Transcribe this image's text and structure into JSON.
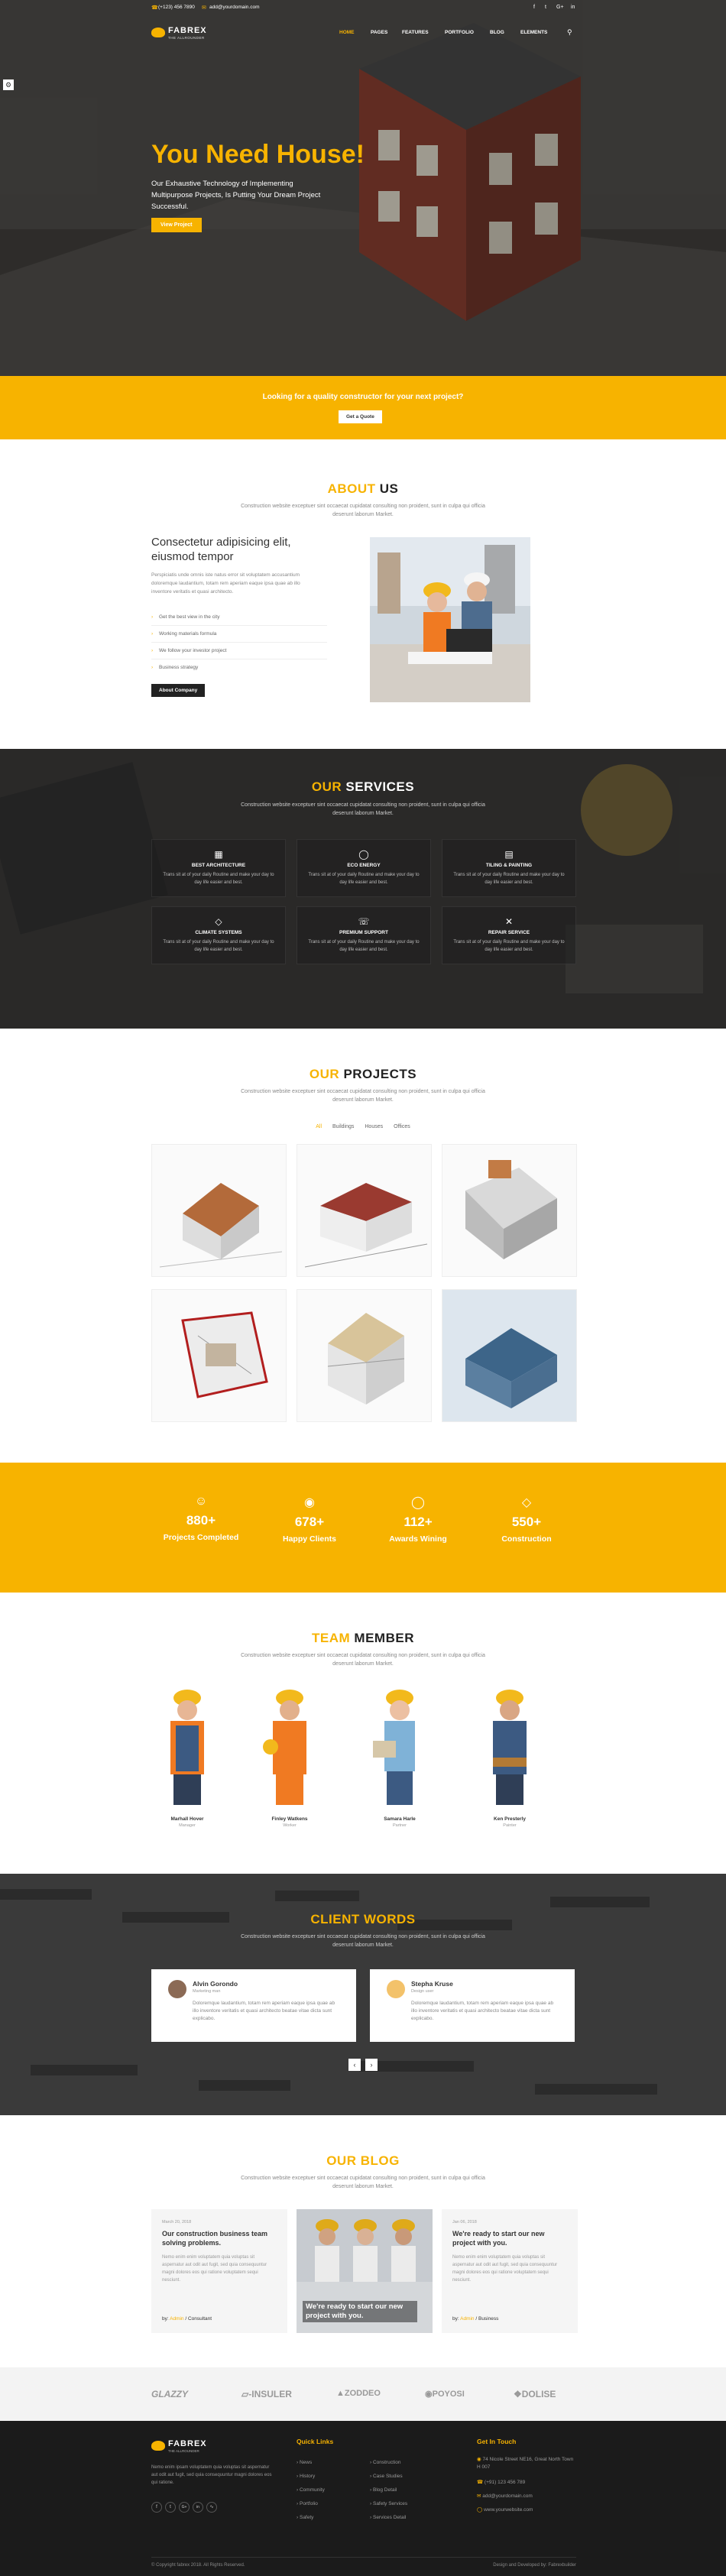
{
  "topbar": {
    "phone": "(+123) 456 7890",
    "email": "add@yourdomain.com"
  },
  "brand": {
    "name": "FABREX",
    "tag": "THE ALLROUNDER"
  },
  "nav": [
    "HOME",
    "PAGES",
    "FEATURES",
    "PORTFOLIO",
    "BLOG",
    "ELEMENTS"
  ],
  "hero": {
    "title": "You Need House!",
    "text": "Our Exhaustive Technology of Implementing Multipurpose Projects, Is Putting Your Dream Project Successful.",
    "button": "View Project"
  },
  "quote": {
    "text": "Looking for a quality constructor for your next project?",
    "button": "Get a Quote"
  },
  "about": {
    "title_y": "ABOUT",
    "title_d": "US",
    "sub": "Construction website exceptuer sint occaecat cupidatat consulting non proident, sunt in culpa qui officia deserunt laborum Market.",
    "heading": "Consectetur adipisicing elit, eiusmod tempor",
    "para": "Perspiciatis unde omnis iste natus error sit voluptatem accusantium doloremque laudantium, totam rem aperiam eaque ipsa quae ab illo inventore veritatis et quasi architecto.",
    "list": [
      "Get the best view in the city",
      "Working materials formula",
      "We follow your investor project",
      "Business strategy"
    ],
    "button": "About Company"
  },
  "services": {
    "title_y": "OUR",
    "title_d": "SERVICES",
    "sub": "Construction website exceptuer sint occaecat cupidatat consulting non proident, sunt in culpa qui officia deserunt laborum Market.",
    "items": [
      {
        "title": "BEST ARCHITECTURE",
        "icon": "building-icon"
      },
      {
        "title": "ECO ENERGY",
        "icon": "bulb-icon"
      },
      {
        "title": "TILING & PAINTING",
        "icon": "roller-icon"
      },
      {
        "title": "CLIMATE SYSTEMS",
        "icon": "diamond-icon"
      },
      {
        "title": "PREMIUM SUPPORT",
        "icon": "support-icon"
      },
      {
        "title": "REPAIR SERVICE",
        "icon": "tools-icon"
      }
    ],
    "text": "Trans sit at of your daily Routine and make your day to day life easier and best."
  },
  "projects": {
    "title_y": "OUR",
    "title_d": "PROJECTS",
    "sub": "Construction website exceptuer sint occaecat cupidatat consulting non proident, sunt in culpa qui officia deserunt laborum Market.",
    "filters": [
      "All",
      "Buildings",
      "Houses",
      "Offices"
    ]
  },
  "counters": [
    {
      "num": "880+",
      "label": "Projects Completed",
      "icon": "smile-icon"
    },
    {
      "num": "678+",
      "label": "Happy Clients",
      "icon": "location-icon"
    },
    {
      "num": "112+",
      "label": "Awards Wining",
      "icon": "globe-icon"
    },
    {
      "num": "550+",
      "label": "Construction",
      "icon": "diamond-icon"
    }
  ],
  "team": {
    "title_y": "TEAM",
    "title_d": "MEMBER",
    "sub": "Construction website exceptuer sint occaecat cupidatat consulting non proident, sunt in culpa qui officia deserunt laborum Market.",
    "members": [
      {
        "name": "Marhall Hover",
        "role": "Manager"
      },
      {
        "name": "Finley Watkens",
        "role": "Worker"
      },
      {
        "name": "Samara Harle",
        "role": "Partner"
      },
      {
        "name": "Ken Presterly",
        "role": "Painter"
      }
    ]
  },
  "testimonials": {
    "title_y": "CLIENT",
    "title_d": "WORDS",
    "sub": "Construction website exceptuer sint occaecat cupidatat consulting non proident, sunt in culpa qui officia deserunt laborum Market.",
    "items": [
      {
        "name": "Alvin Gorondo",
        "role": "Marketing man",
        "text": "Doloremque laudantium, totam rem aperiam eaque ipsa quae ab illo inventore veritatis et quasi architecto beatae vitae dicta sunt explicabo."
      },
      {
        "name": "Stepha Kruse",
        "role": "Design user",
        "text": "Doloremque laudantium, totam rem aperiam eaque ipsa quae ab illo inventore veritatis et quasi architecto beatae vitae dicta sunt explicabo."
      }
    ]
  },
  "blog": {
    "title_y": "OUR",
    "title_d": "BLOG",
    "sub": "Construction website exceptuer sint occaecat cupidatat consulting non proident, sunt in culpa qui officia deserunt laborum Market.",
    "posts": [
      {
        "date": "March 20, 2018",
        "title": "Our construction business team solving problems.",
        "text": "Nemo enim enim voluptatem quia voluptas sit aspernatur aut odit aut fugit, sed quia consequuntur magni dolores eos qui ratione voluptatem sequi nesciunt.",
        "by": "by:",
        "author": "Admin",
        "cat": "/ Consultant"
      },
      {
        "title": "We're ready to start our new project with you."
      },
      {
        "date": "Jan 06, 2018",
        "title": "We're ready to start our new project with you.",
        "text": "Nemo enim enim voluptatem quia voluptas sit aspernatur aut odit aut fugit, sed quia consequuntur magni dolores eos qui ratione voluptatem sequi nesciunt.",
        "by": "by:",
        "author": "Admin",
        "cat": "/ Business"
      }
    ]
  },
  "logos": [
    "GLAZZY",
    "INSULER",
    "ZODDEO",
    "POYOSI",
    "DOLISE"
  ],
  "footer": {
    "about": "Nemo enim ipsam voluptatem quia voluptas sit aspernatur aut odit aut fugit, sed quia consequuntur magni dolores eos qui ratione.",
    "quick_title": "Quick Links",
    "links1": [
      "News",
      "History",
      "Community",
      "Portfolio",
      "Safety"
    ],
    "links2": [
      "Construction",
      "Case Studies",
      "Blog Detail",
      "Safety Services",
      "Services Detail"
    ],
    "contact_title": "Get In Touch",
    "contact": [
      "74 Nicole Street NE16, Great North Town H 007",
      "(+91) 123 456 789",
      "add@yourdomain.com",
      "www.yourwebsite.com"
    ],
    "copyright": "© Copyright fabrex 2018. All Rights Reserved.",
    "credit": "Design and Developed by: Fabrexbuilder"
  }
}
